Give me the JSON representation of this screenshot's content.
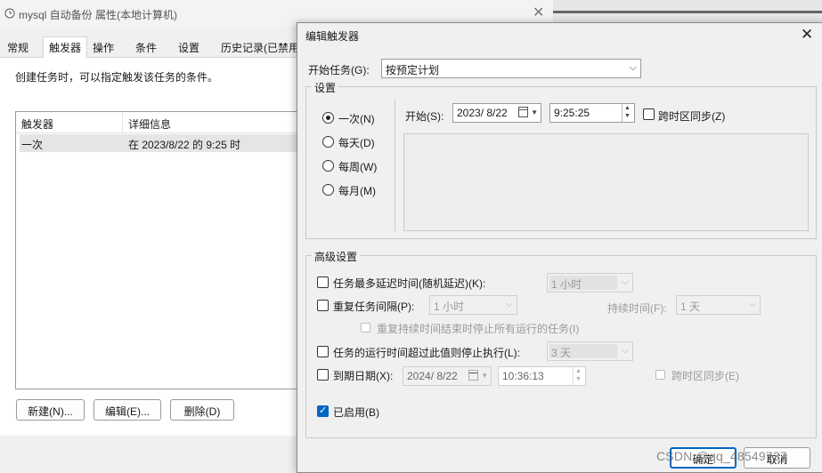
{
  "background_window": {
    "title": "mysql 自动备份 属性(本地计算机)",
    "tabs": [
      "常规",
      "触发器",
      "操作",
      "条件",
      "设置",
      "历史记录(已禁用"
    ],
    "active_tab": "触发器",
    "description": "创建任务时，可以指定触发该任务的条件。",
    "list": {
      "headers": [
        "触发器",
        "详细信息"
      ],
      "rows": [
        {
          "trigger": "一次",
          "details": "在 2023/8/22 的 9:25 时"
        }
      ]
    },
    "buttons": {
      "new": "新建(N)...",
      "edit": "编辑(E)...",
      "delete": "删除(D)"
    }
  },
  "dialog": {
    "title": "编辑触发器",
    "start_task_label": "开始任务(G):",
    "start_task_value": "按预定计划",
    "settings": {
      "title": "设置",
      "radios": [
        {
          "label": "一次(N)",
          "checked": true
        },
        {
          "label": "每天(D)",
          "checked": false
        },
        {
          "label": "每周(W)",
          "checked": false
        },
        {
          "label": "每月(M)",
          "checked": false
        }
      ],
      "start_label": "开始(S):",
      "start_date": "2023/  8/22",
      "start_time": "9:25:25",
      "sync_timezone": "跨时区同步(Z)"
    },
    "advanced": {
      "title": "高级设置",
      "delay_label": "任务最多延迟时间(随机延迟)(K):",
      "delay_value": "1 小时",
      "repeat_label": "重复任务间隔(P):",
      "repeat_value": "1 小时",
      "duration_label": "持续时间(F):",
      "duration_value": "1 天",
      "stop_repeat_label": "重复持续时间结束时停止所有运行的任务(I)",
      "stop_if_label": "任务的运行时间超过此值则停止执行(L):",
      "stop_if_value": "3 天",
      "expire_label": "到期日期(X):",
      "expire_date": "2024/  8/22",
      "expire_time": "10:36:13",
      "expire_sync_label": "跨时区同步(E)",
      "enabled_label": "已启用(B)",
      "enabled": true
    },
    "buttons": {
      "ok": "确定",
      "cancel": "取消"
    }
  },
  "watermark": "CSDN @qq_48549737",
  "colors": {
    "accent": "#0067c0"
  }
}
